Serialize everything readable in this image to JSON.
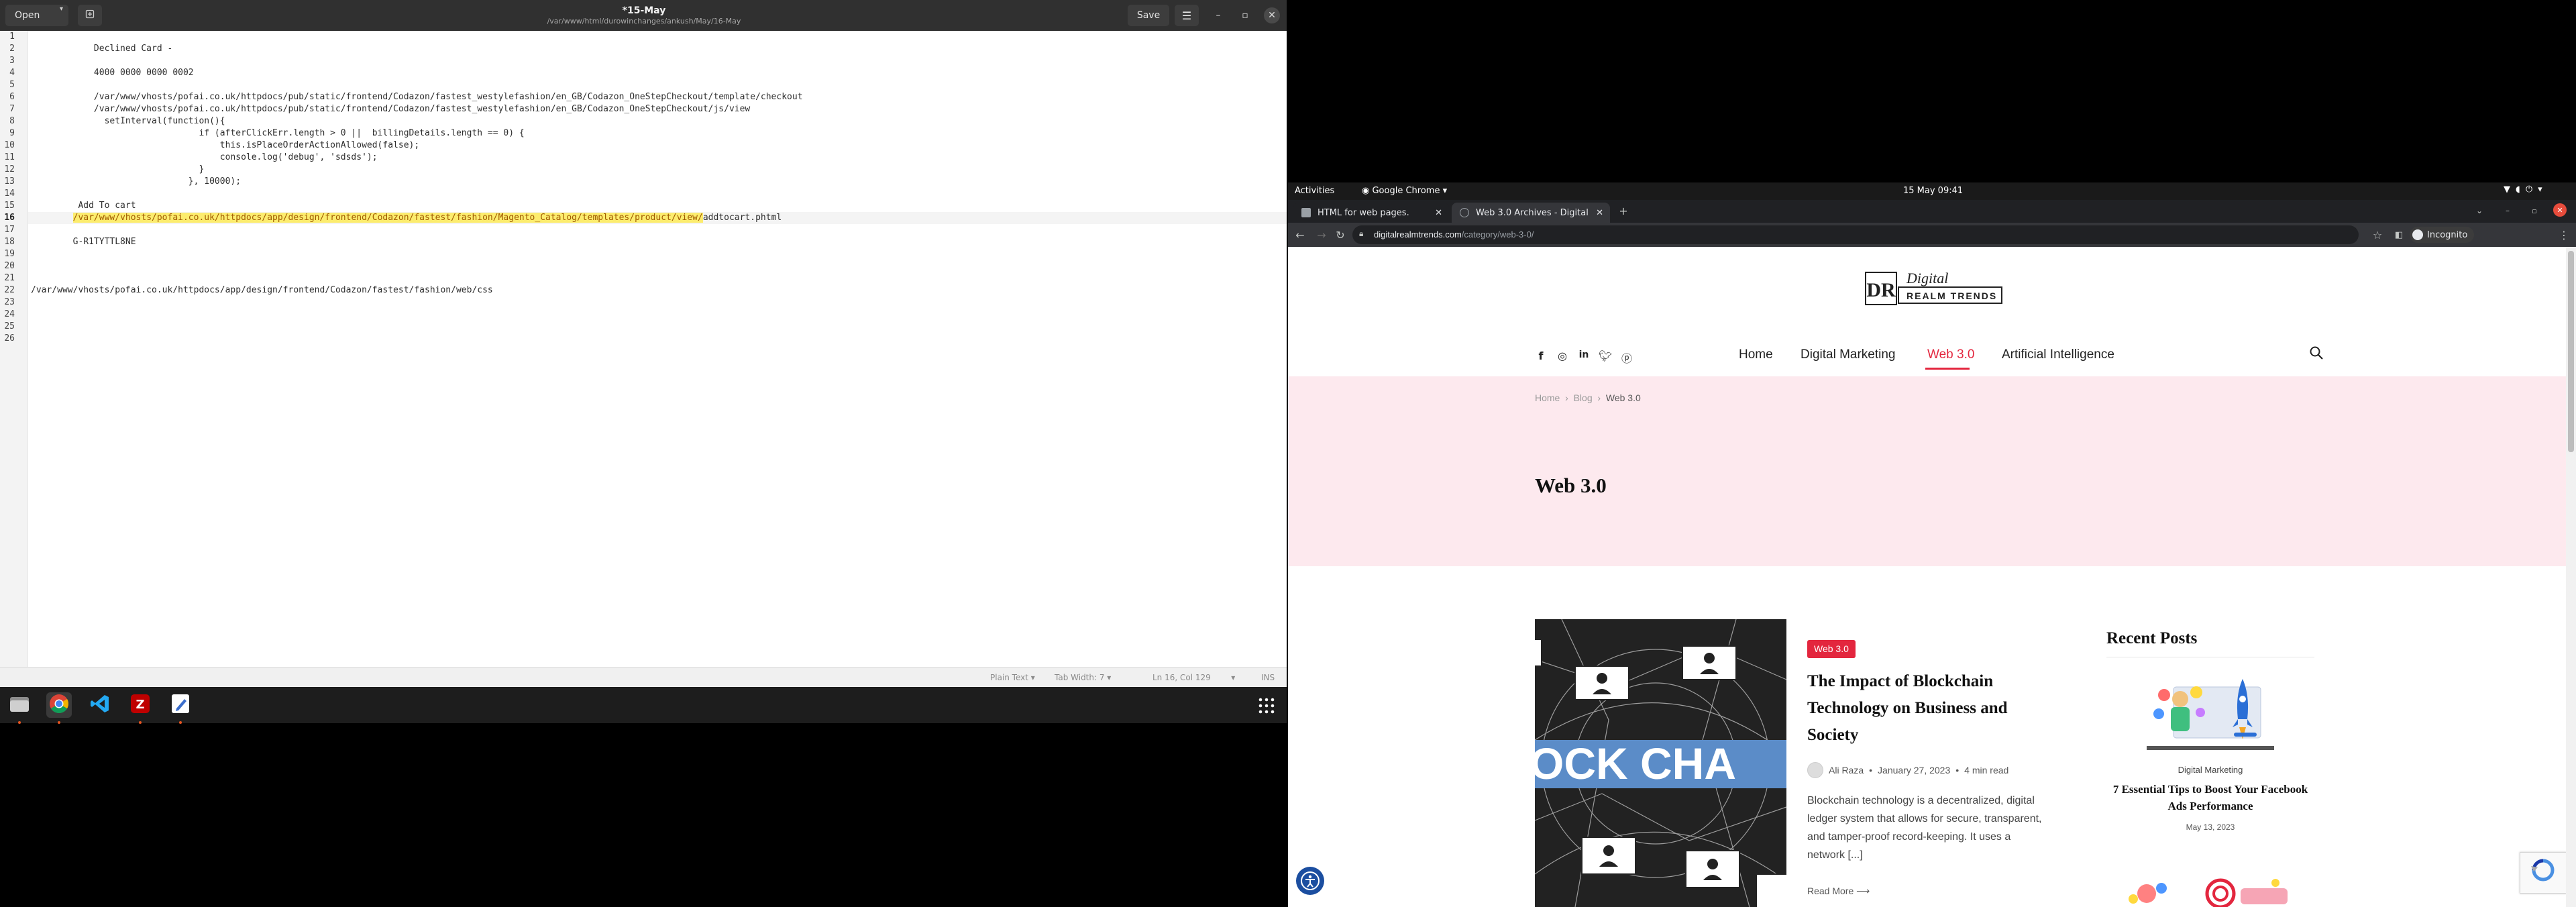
{
  "gedit": {
    "title": "*15-May",
    "subtitle": "/var/www/html/durowinchanges/ankush/May/16-May",
    "open_label": "Open",
    "save_label": "Save",
    "lines": [
      {
        "n": "1",
        "text": ""
      },
      {
        "n": "2",
        "text": "            Declined Card -"
      },
      {
        "n": "3",
        "text": ""
      },
      {
        "n": "4",
        "text": "            4000 0000 0000 0002"
      },
      {
        "n": "5",
        "text": ""
      },
      {
        "n": "6",
        "text": "            /var/www/vhosts/pofai.co.uk/httpdocs/pub/static/frontend/Codazon/fastest_westylefashion/en_GB/Codazon_OneStepCheckout/template/checkout"
      },
      {
        "n": "7",
        "text": "            /var/www/vhosts/pofai.co.uk/httpdocs/pub/static/frontend/Codazon/fastest_westylefashion/en_GB/Codazon_OneStepCheckout/js/view"
      },
      {
        "n": "8",
        "text": "              setInterval(function(){"
      },
      {
        "n": "9",
        "text": "                                if (afterClickErr.length > 0 ||  billingDetails.length == 0) {"
      },
      {
        "n": "10",
        "text": "                                    this.isPlaceOrderActionAllowed(false);"
      },
      {
        "n": "11",
        "text": "                                    console.log('debug', 'sdsds');"
      },
      {
        "n": "12",
        "text": "                                }"
      },
      {
        "n": "13",
        "text": "                              }, 10000);"
      },
      {
        "n": "14",
        "text": ""
      },
      {
        "n": "15",
        "text": "         Add To cart"
      },
      {
        "n": "16",
        "text": "",
        "highlight": "/var/www/vhosts/pofai.co.uk/httpdocs/app/design/frontend/Codazon/fastest/fashion/Magento_Catalog/templates/product/view/",
        "rest": "addtocart.phtml",
        "indent": "        "
      },
      {
        "n": "17",
        "text": ""
      },
      {
        "n": "18",
        "text": "        G-R1TYTTL8NE"
      },
      {
        "n": "19",
        "text": ""
      },
      {
        "n": "20",
        "text": ""
      },
      {
        "n": "21",
        "text": ""
      },
      {
        "n": "22",
        "text": "/var/www/vhosts/pofai.co.uk/httpdocs/app/design/frontend/Codazon/fastest/fashion/web/css"
      },
      {
        "n": "23",
        "text": ""
      },
      {
        "n": "24",
        "text": ""
      },
      {
        "n": "25",
        "text": ""
      },
      {
        "n": "26",
        "text": ""
      }
    ],
    "current_line": "16",
    "status": {
      "language": "Plain Text",
      "tab_width": "Tab Width: 7",
      "position": "Ln 16, Col 129",
      "mode": "INS"
    }
  },
  "dock": {
    "apps": [
      "files-icon",
      "chrome-icon",
      "vscode-icon",
      "filezilla-icon",
      "text-editor-icon"
    ]
  },
  "topbar": {
    "activities": "Activities",
    "app_menu": "Google Chrome",
    "clock": "15 May  09:41"
  },
  "chrome": {
    "tabs": [
      {
        "title": "HTML for web pages.",
        "active": false
      },
      {
        "title": "Web 3.0 Archives - Digital",
        "active": true
      }
    ],
    "url_host": "digitalrealmtrends.com",
    "url_path": "/category/web-3-0/",
    "profile": "Incognito"
  },
  "site": {
    "logo_script": "Digital",
    "logo_text": "REALM TRENDS",
    "logo_mark": "DR",
    "nav": [
      "Home",
      "Digital Marketing",
      "Web 3.0",
      "Artificial Intelligence"
    ],
    "nav_active": "Web 3.0",
    "breadcrumb": [
      "Home",
      "Blog",
      "Web 3.0"
    ],
    "page_title": "Web 3.0",
    "post": {
      "category": "Web 3.0",
      "title": "The Impact of Blockchain Technology on Business and Society",
      "author": "Ali Raza",
      "date": "January 27, 2023",
      "read_time": "4 min read",
      "excerpt": "Blockchain technology is a decentralized, digital ledger system that allows for secure, transparent, and tamper-proof record-keeping. It uses a network [...]",
      "read_more": "Read More",
      "image_text": "OCK CHA"
    },
    "sidebar": {
      "title": "Recent Posts",
      "post": {
        "category": "Digital Marketing",
        "title": "7 Essential Tips to Boost Your Facebook Ads Performance",
        "date": "May 13, 2023"
      }
    }
  },
  "colors": {
    "accent": "#e3263e",
    "hero_bg": "#fde9ee",
    "highlight": "#fcec6e"
  }
}
